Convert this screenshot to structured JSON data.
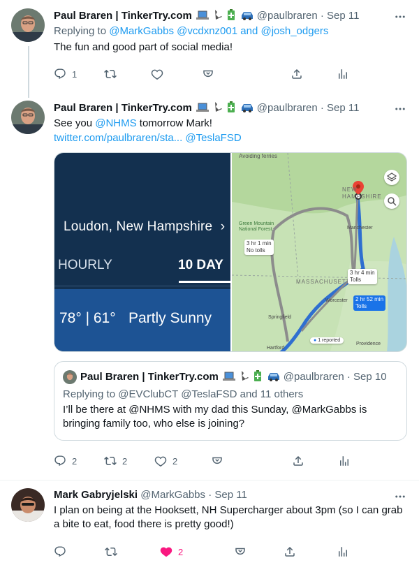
{
  "tweet1": {
    "author_name": "Paul Braren | TinkerTry.com",
    "handle": "@paulbraren",
    "dot": "·",
    "date": "Sep 11",
    "replying_label": "Replying to",
    "replying_users": "@MarkGabbs @vcdxnz001",
    "replying_and": "and",
    "replying_last": "@josh_odgers",
    "text": "The fun and good part of social media!",
    "reply_count": "1"
  },
  "tweet2": {
    "author_name": "Paul Braren | TinkerTry.com",
    "handle": "@paulbraren",
    "dot": "·",
    "date": "Sep 11",
    "text_prefix": "See you",
    "mention": "@NHMS",
    "text_suffix": "tomorrow Mark!",
    "link_text": "twitter.com/paulbraren/sta...",
    "link_mention": "@TeslaFSD",
    "weather": {
      "location": "Loudon, New Hampshire",
      "chevron": "›",
      "tab_hourly": "HOURLY",
      "tab_10day": "10 DAY",
      "temps": "78° | 61°",
      "condition": "Partly Sunny"
    },
    "map": {
      "top_label": "Avoiding ferries",
      "region_new_hampshire": "NEW HAMPSHIRE",
      "region_massachusetts": "MASSACHUSETTS",
      "forest_label": "Green Mountain National Forest",
      "city_manchester": "Manchester",
      "city_worcester": "Worcester",
      "city_springfield": "Springfield",
      "city_hartford": "Hartford",
      "city_providence": "Providence",
      "route1_time": "3 hr 1 min",
      "route1_note": "No tolls",
      "route2_time": "3 hr 4 min",
      "route2_note": "Tolls",
      "route3_time": "2 hr 52 min",
      "route3_note": "Tolls",
      "reported": "1 reported"
    },
    "quote": {
      "author_name": "Paul Braren | TinkerTry.com",
      "handle": "@paulbraren",
      "dot": "·",
      "date": "Sep 10",
      "replying": "Replying to @EVClubCT @TeslaFSD and 11 others",
      "text": "I’ll be there at @NHMS with my dad this Sunday, @MarkGabbs is bringing family too, who else is joining?"
    },
    "reply_count": "2",
    "retweet_count": "2",
    "like_count": "2"
  },
  "tweet3": {
    "author_name": "Mark Gabryjelski",
    "handle": "@MarkGabbs",
    "dot": "·",
    "date": "Sep 11",
    "text": "I plan on being at the Hooksett, NH Supercharger about 3pm (so I can grab a bite to eat, food there is pretty good!)",
    "like_count": "2",
    "like_color": "#f91880"
  },
  "colors": {
    "link": "#1d9bf0",
    "muted": "#536471",
    "weather_dark": "#13304f",
    "weather_band": "#1d5394",
    "map_green": "#b9dba8"
  }
}
